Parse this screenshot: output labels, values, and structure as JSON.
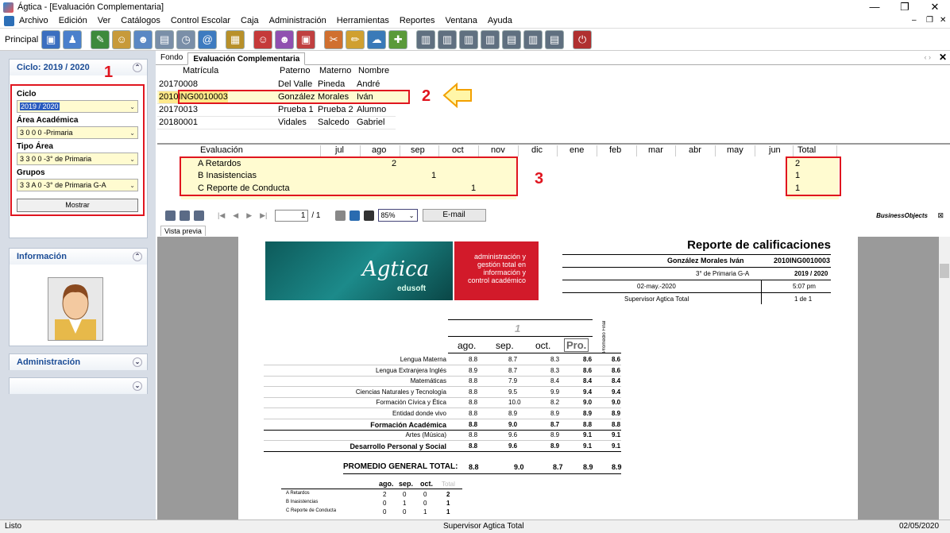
{
  "window": {
    "title": "Ágtica - [Evaluación Complementaria]"
  },
  "menu": [
    "Archivo",
    "Edición",
    "Ver",
    "Catálogos",
    "Control Escolar",
    "Caja",
    "Administración",
    "Herramientas",
    "Reportes",
    "Ventana",
    "Ayuda"
  ],
  "toolbar": {
    "label": "Principal"
  },
  "ciclo_panel": {
    "title": "Ciclo: 2019 / 2020",
    "ciclo_label": "Ciclo",
    "ciclo_value": "2019 / 2020",
    "area_label": "Área Académica",
    "area_value": "3 0 0 0 -Primaria",
    "tipo_label": "Tipo Área",
    "tipo_value": "3 3 0 0 -3° de Primaria",
    "grupos_label": "Grupos",
    "grupos_value": "3 3 A 0 -3° de Primaria G-A",
    "button": "Mostrar"
  },
  "info_panel": {
    "title": "Información"
  },
  "admin_panel": {
    "title": "Administración"
  },
  "tabs": [
    "Fondo",
    "Evaluación Complementaria"
  ],
  "students": {
    "headers": [
      "Matrícula",
      "Paterno",
      "Materno",
      "Nombre"
    ],
    "rows": [
      [
        "20170008",
        "Del Valle",
        "Pineda",
        "André"
      ],
      [
        "2010ING0010003",
        "González",
        "Morales",
        "Iván"
      ],
      [
        "20170013",
        "Prueba 1",
        "Prueba 2",
        "Alumno"
      ],
      [
        "20180001",
        "Vidales",
        "Salcedo",
        "Gabriel"
      ]
    ]
  },
  "eval": {
    "headers": [
      "Evaluación",
      "jul",
      "ago",
      "sep",
      "oct",
      "nov",
      "dic",
      "ene",
      "feb",
      "mar",
      "abr",
      "may",
      "jun",
      "Total"
    ],
    "rows": [
      {
        "name": "A Retardos",
        "ago": "2",
        "sep": "",
        "oct": "",
        "total": "2"
      },
      {
        "name": "B Inasistencias",
        "ago": "",
        "sep": "1",
        "oct": "",
        "total": "1"
      },
      {
        "name": "C Reporte de Conducta",
        "ago": "",
        "sep": "",
        "oct": "1",
        "total": "1"
      }
    ]
  },
  "annotations": {
    "a1": "1",
    "a2": "2",
    "a3": "3"
  },
  "report_toolbar": {
    "page": "1",
    "of": "/ 1",
    "zoom": "85%",
    "email": "E-mail",
    "brand": "BusinessObjects"
  },
  "preview_tab": "Vista previa",
  "report": {
    "title": "Reporte de calificaciones",
    "student": "González Morales Iván",
    "id": "2010ING0010003",
    "group": "3° de Primaria G-A",
    "cycle": "2019 / 2020",
    "date": "02-may.-2020",
    "time": "5:07 pm",
    "user": "Supervisor Agtica Total",
    "pages": "1 de 1",
    "logo_text": "Agtica",
    "logo_sub": "edusoft",
    "slogan": "administración y gestión total en información y control académico",
    "period": "1",
    "cols": [
      "ago.",
      "sep.",
      "oct.",
      "Pro."
    ],
    "promedio_final": "Promedio Final",
    "subjects": [
      {
        "name": "Lengua Materna",
        "v": [
          "8.8",
          "8.7",
          "8.3",
          "8.6",
          "8.6"
        ],
        "bold": false
      },
      {
        "name": "Lengua Extranjera Inglés",
        "v": [
          "8.9",
          "8.7",
          "8.3",
          "8.6",
          "8.6"
        ],
        "bold": false
      },
      {
        "name": "Matemáticas",
        "v": [
          "8.8",
          "7.9",
          "8.4",
          "8.4",
          "8.4"
        ],
        "bold": false
      },
      {
        "name": "Ciencias Naturales y Tecnología",
        "v": [
          "8.8",
          "9.5",
          "9.9",
          "9.4",
          "9.4"
        ],
        "bold": false
      },
      {
        "name": "Formación Cívica y Ética",
        "v": [
          "8.8",
          "10.0",
          "8.2",
          "9.0",
          "9.0"
        ],
        "bold": false
      },
      {
        "name": "Entidad donde vivo",
        "v": [
          "8.8",
          "8.9",
          "8.9",
          "8.9",
          "8.9"
        ],
        "bold": false
      },
      {
        "name": "Formación Académica",
        "v": [
          "8.8",
          "9.0",
          "8.7",
          "8.8",
          "8.8"
        ],
        "bold": true
      },
      {
        "name": "Artes (Música)",
        "v": [
          "8.8",
          "9.6",
          "8.9",
          "9.1",
          "9.1"
        ],
        "bold": false
      },
      {
        "name": "Desarrollo Personal y Social",
        "v": [
          "8.8",
          "9.6",
          "8.9",
          "9.1",
          "9.1"
        ],
        "bold": true
      }
    ],
    "total_label": "PROMEDIO GENERAL TOTAL:",
    "total": [
      "8.8",
      "9.0",
      "8.7",
      "8.9",
      "8.9"
    ],
    "mini_headers": [
      "ago.",
      "sep.",
      "oct.",
      "Total"
    ],
    "mini_rows": [
      {
        "name": "A Retardos",
        "v": [
          "2",
          "0",
          "0",
          "2"
        ]
      },
      {
        "name": "B Inasistencias",
        "v": [
          "0",
          "1",
          "0",
          "1"
        ]
      },
      {
        "name": "C Reporte de Conducta",
        "v": [
          "0",
          "0",
          "1",
          "1"
        ]
      }
    ]
  },
  "status": {
    "left": "Listo",
    "center": "Supervisor Agtica Total",
    "right": "02/05/2020"
  }
}
